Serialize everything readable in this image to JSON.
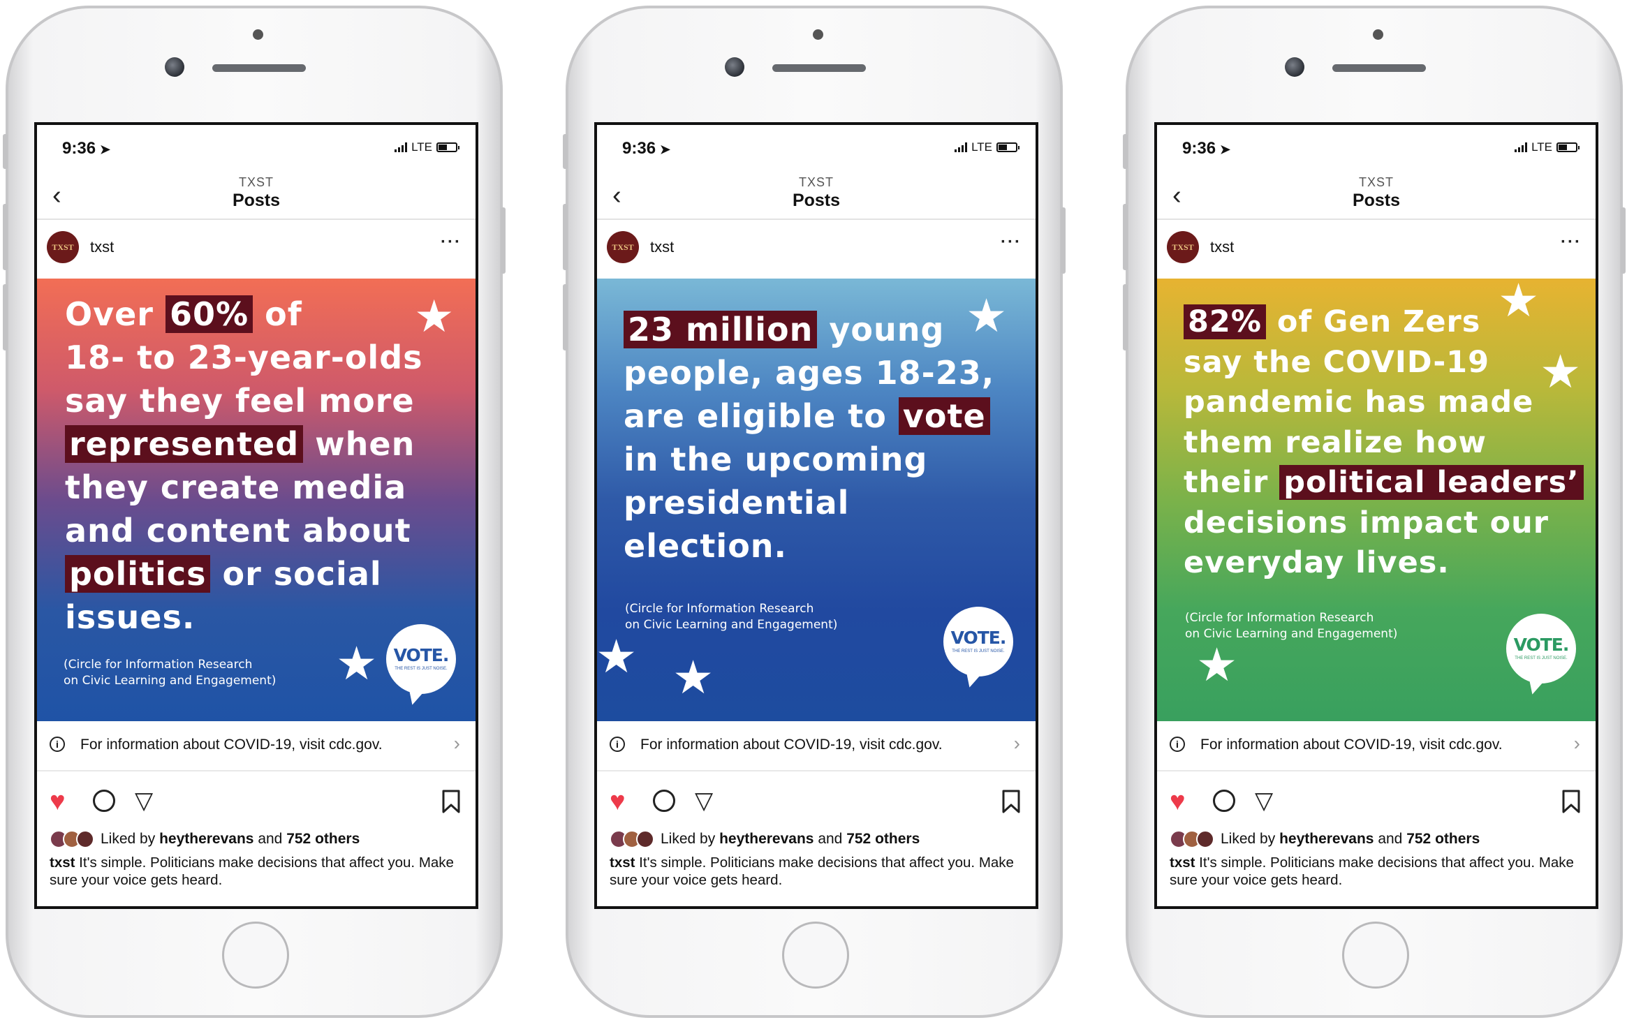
{
  "status": {
    "time": "9:36",
    "network": "LTE"
  },
  "nav": {
    "subtitle": "TXST",
    "title": "Posts"
  },
  "account": {
    "avatar_text": "TXST",
    "username": "txst"
  },
  "info_banner": "For information about COVID-19, visit cdc.gov.",
  "likes": {
    "prefix": "Liked by",
    "user": "heytherevans",
    "middle": "and",
    "others": "752 others"
  },
  "caption": {
    "user": "txst",
    "text": "It's simple. Politicians make decisions that affect you. Make sure your voice gets heard."
  },
  "vote_badge": {
    "title": "VOTE.",
    "tagline": "THE REST IS JUST NOISE."
  },
  "posts": [
    {
      "lines": [
        {
          "pre": "Over ",
          "hl": "60%",
          "post": " of"
        },
        {
          "pre": "18- to 23-year-olds",
          "hl": "",
          "post": ""
        },
        {
          "pre": "say they feel more",
          "hl": "",
          "post": ""
        },
        {
          "pre": "",
          "hl": "represented",
          "post": " when"
        },
        {
          "pre": "they create media",
          "hl": "",
          "post": ""
        },
        {
          "pre": "and content about",
          "hl": "",
          "post": ""
        },
        {
          "pre": "",
          "hl": "politics",
          "post": " or social"
        },
        {
          "pre": "issues.",
          "hl": "",
          "post": ""
        }
      ],
      "source": [
        "(Circle for Information Research",
        "on Civic Learning and Engagement)"
      ],
      "gradient": [
        "#f26e55",
        "#cf5a6a",
        "#6c4c8d",
        "#2a57a4",
        "#1f53a6"
      ]
    },
    {
      "lines": [
        {
          "pre": "",
          "hl": "23 million",
          "post": " young"
        },
        {
          "pre": "people, ages 18-23,",
          "hl": "",
          "post": ""
        },
        {
          "pre": "are eligible to ",
          "hl": "vote",
          "post": ""
        },
        {
          "pre": "in the upcoming",
          "hl": "",
          "post": ""
        },
        {
          "pre": "presidential",
          "hl": "",
          "post": ""
        },
        {
          "pre": "election.",
          "hl": "",
          "post": ""
        }
      ],
      "source": [
        "(Circle for Information Research",
        "on Civic Learning and Engagement)"
      ],
      "gradient": [
        "#7ab8d6",
        "#4d86c3",
        "#2f5aa8",
        "#2149a0",
        "#1d4c9f"
      ]
    },
    {
      "lines": [
        {
          "pre": "",
          "hl": "82%",
          "post": " of Gen Zers"
        },
        {
          "pre": "say the COVID-19",
          "hl": "",
          "post": ""
        },
        {
          "pre": "pandemic has made",
          "hl": "",
          "post": ""
        },
        {
          "pre": "them realize how",
          "hl": "",
          "post": ""
        },
        {
          "pre": "their ",
          "hl": "political leaders’",
          "post": ""
        },
        {
          "pre": "decisions impact our",
          "hl": "",
          "post": ""
        },
        {
          "pre": "everyday lives.",
          "hl": "",
          "post": ""
        }
      ],
      "source": [
        "(Circle for Information Research",
        "on Civic Learning and Engagement)"
      ],
      "gradient": [
        "#e7b331",
        "#b9b83a",
        "#7bb24a",
        "#46a75c",
        "#39a05e"
      ]
    }
  ]
}
